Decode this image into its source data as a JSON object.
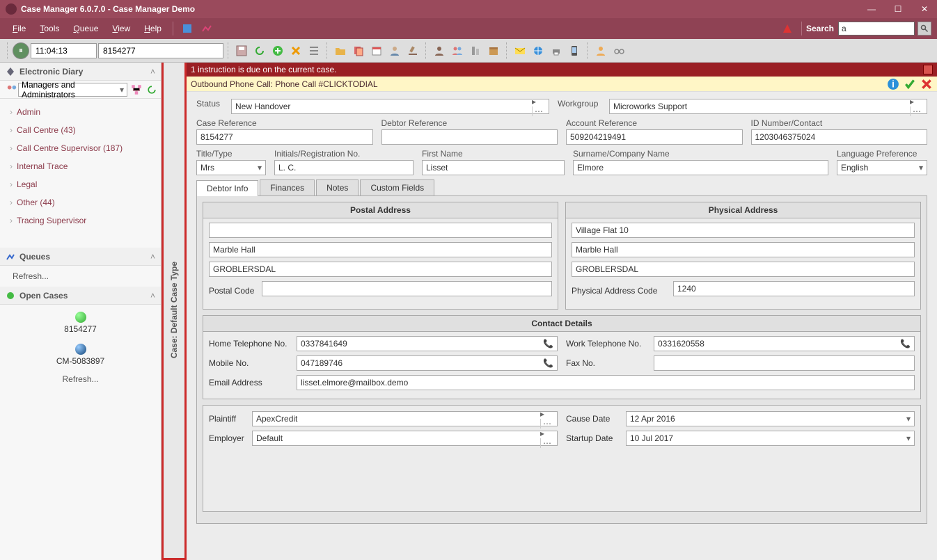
{
  "titlebar": {
    "title": "Case Manager 6.0.7.0 - Case Manager Demo"
  },
  "menu": {
    "file": "File",
    "tools": "Tools",
    "queue": "Queue",
    "view": "View",
    "help": "Help",
    "search_label": "Search",
    "search_value": "a"
  },
  "toolbar": {
    "time": "11:04:13",
    "case_ref": "8154277"
  },
  "instr_bar": "1 instruction is due on the current case.",
  "outbound_bar": "Outbound Phone Call: Phone Call #CLICKTODIAL",
  "sidebar": {
    "diary_header": "Electronic Diary",
    "role_dd": "Managers and Administrators",
    "tree": [
      {
        "label": "Admin"
      },
      {
        "label": "Call Centre (43)"
      },
      {
        "label": "Call Centre Supervisor (187)"
      },
      {
        "label": "Internal Trace"
      },
      {
        "label": "Legal"
      },
      {
        "label": "Other (44)"
      },
      {
        "label": "Tracing Supervisor"
      }
    ],
    "queues_header": "Queues",
    "refresh": "Refresh...",
    "open_cases_header": "Open Cases",
    "open_cases": [
      {
        "label": "8154277",
        "color": "#4ec24e"
      },
      {
        "label": "CM-5083897",
        "color": "#2a6ed6"
      }
    ]
  },
  "vtab": "Case: Default Case Type",
  "form": {
    "status_label": "Status",
    "status_value": "New Handover",
    "workgroup_label": "Workgroup",
    "workgroup_value": "Microworks Support",
    "case_ref_label": "Case Reference",
    "case_ref_value": "8154277",
    "debtor_ref_label": "Debtor Reference",
    "debtor_ref_value": "",
    "account_ref_label": "Account Reference",
    "account_ref_value": "509204219491",
    "id_number_label": "ID Number/Contact",
    "id_number_value": "1203046375024",
    "title_label": "Title/Type",
    "title_value": "Mrs",
    "initials_label": "Initials/Registration No.",
    "initials_value": "L. C.",
    "first_name_label": "First Name",
    "first_name_value": "Lisset",
    "surname_label": "Surname/Company Name",
    "surname_value": "Elmore",
    "lang_label": "Language Preference",
    "lang_value": "English",
    "tabs": {
      "debtor": "Debtor Info",
      "finances": "Finances",
      "notes": "Notes",
      "custom": "Custom Fields"
    },
    "postal_hdr": "Postal Address",
    "physical_hdr": "Physical Address",
    "postal": {
      "l1": "",
      "l2": "Marble Hall",
      "l3": "GROBLERSDAL",
      "postal_code_label": "Postal Code",
      "postal_code": ""
    },
    "physical": {
      "l1": "Village Flat 10",
      "l2": "Marble Hall",
      "l3": "GROBLERSDAL",
      "code_label": "Physical Address Code",
      "code": "1240"
    },
    "contact_hdr": "Contact Details",
    "home_tel_label": "Home Telephone No.",
    "home_tel": "0337841649",
    "work_tel_label": "Work Telephone No.",
    "work_tel": "0331620558",
    "mobile_label": "Mobile No.",
    "mobile": "047189746",
    "fax_label": "Fax No.",
    "fax": "",
    "email_label": "Email Address",
    "email": "lisset.elmore@mailbox.demo",
    "plaintiff_label": "Plaintiff",
    "plaintiff": "ApexCredit",
    "cause_date_label": "Cause Date",
    "cause_date": "12 Apr 2016",
    "employer_label": "Employer",
    "employer": "Default",
    "startup_date_label": "Startup Date",
    "startup_date": "10 Jul 2017"
  }
}
